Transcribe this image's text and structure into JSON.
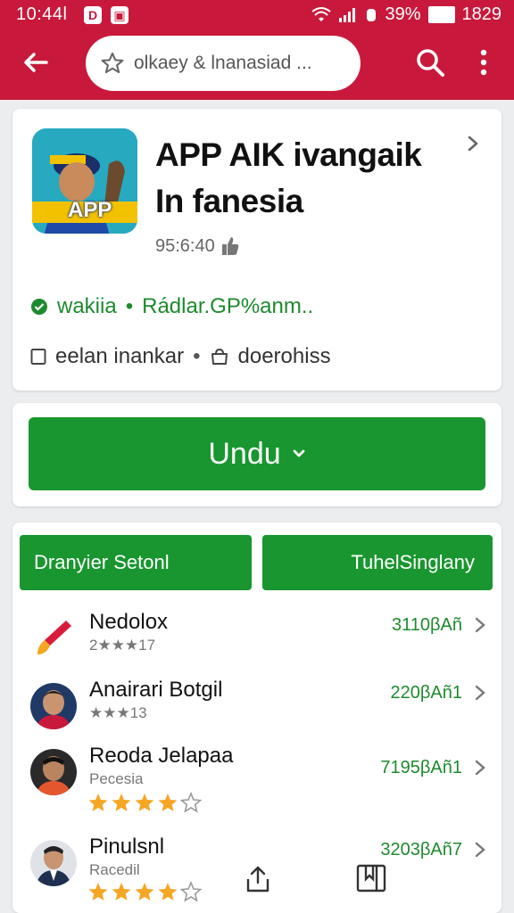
{
  "status_bar": {
    "time": "10:44l",
    "battery_text": "39%",
    "clock_right": "1829"
  },
  "search": {
    "query": "olkaey & lnanasiad ..."
  },
  "app": {
    "title_line1": "APP AIK ivangaik",
    "title_line2": "In fanesia",
    "icon_label": "APP",
    "meta": "95:6:40",
    "info_primary": "wakiia",
    "info_primary_link": "Rádlar.GP%anm..",
    "info_secondary_a": "eelan inankar",
    "info_secondary_b": "doerohiss"
  },
  "download": {
    "label": "Undu"
  },
  "tabs": [
    {
      "label": "Dranyier Setonl"
    },
    {
      "label": "TuhelSinglany"
    }
  ],
  "list": [
    {
      "name": "Nedolox",
      "sub": "",
      "rating_text": "2★★★17",
      "rating": 0,
      "price": "3110βAñ"
    },
    {
      "name": "Anairari Botgil",
      "sub": "",
      "rating_text": "★★★13",
      "rating": 0,
      "price": "220βAñ1"
    },
    {
      "name": "Reoda Jelapaa",
      "sub": "Pecesia",
      "rating_text": "",
      "rating": 4,
      "price": "7195βAñ1"
    },
    {
      "name": "Pinulsnl",
      "sub": "Racedil",
      "rating_text": "",
      "rating": 4,
      "price": "3203βAñ7"
    }
  ],
  "colors": {
    "appbar": "#c8193c",
    "primary_green": "#19962f",
    "star": "#f5a623"
  },
  "icons": [
    "back-arrow-icon",
    "star-outline-icon",
    "search-icon",
    "more-vert-icon",
    "chevron-right-icon",
    "thumbs-up-icon",
    "check-circle-icon",
    "square-icon",
    "bag-icon",
    "chevron-down-icon",
    "share-icon",
    "bookmark-icon"
  ]
}
